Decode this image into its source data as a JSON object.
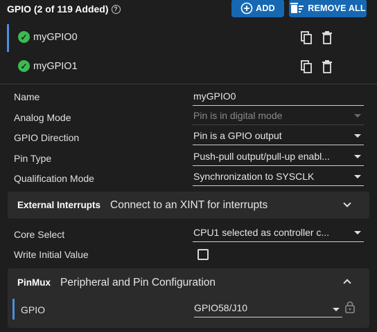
{
  "header": {
    "title": "GPIO (2 of 119 Added)",
    "help_icon": "help-circle-icon",
    "add_label": "ADD",
    "remove_all_label": "REMOVE ALL"
  },
  "gpio_list": [
    {
      "name": "myGPIO0",
      "selected": true,
      "status": "check-circle-icon"
    },
    {
      "name": "myGPIO1",
      "selected": false,
      "status": "check-circle-icon"
    }
  ],
  "form": {
    "name": {
      "label": "Name",
      "value": "myGPIO0"
    },
    "analog_mode": {
      "label": "Analog Mode",
      "value": "Pin is in digital mode"
    },
    "gpio_direction": {
      "label": "GPIO Direction",
      "value": "Pin is a GPIO output"
    },
    "pin_type": {
      "label": "Pin Type",
      "value": "Push-pull output/pull-up enabl..."
    },
    "qualification_mode": {
      "label": "Qualification Mode",
      "value": "Synchronization to SYSCLK"
    },
    "core_select": {
      "label": "Core Select",
      "value": "CPU1 selected as controller c..."
    },
    "write_initial_value": {
      "label": "Write Initial Value",
      "checked": false
    }
  },
  "external_interrupts": {
    "title": "External Interrupts",
    "description": "Connect to an XINT for interrupts",
    "expanded": false
  },
  "pinmux": {
    "title": "PinMux",
    "description": "Peripheral and Pin Configuration",
    "expanded": true,
    "gpio_label": "GPIO",
    "gpio_value": "GPIO58/J10"
  },
  "colors": {
    "background": "#1e1e1e",
    "button": "#1668b3",
    "selection_indicator": "#4a90e2",
    "check": "#3cba54",
    "section_bg": "#2b2b2b"
  }
}
